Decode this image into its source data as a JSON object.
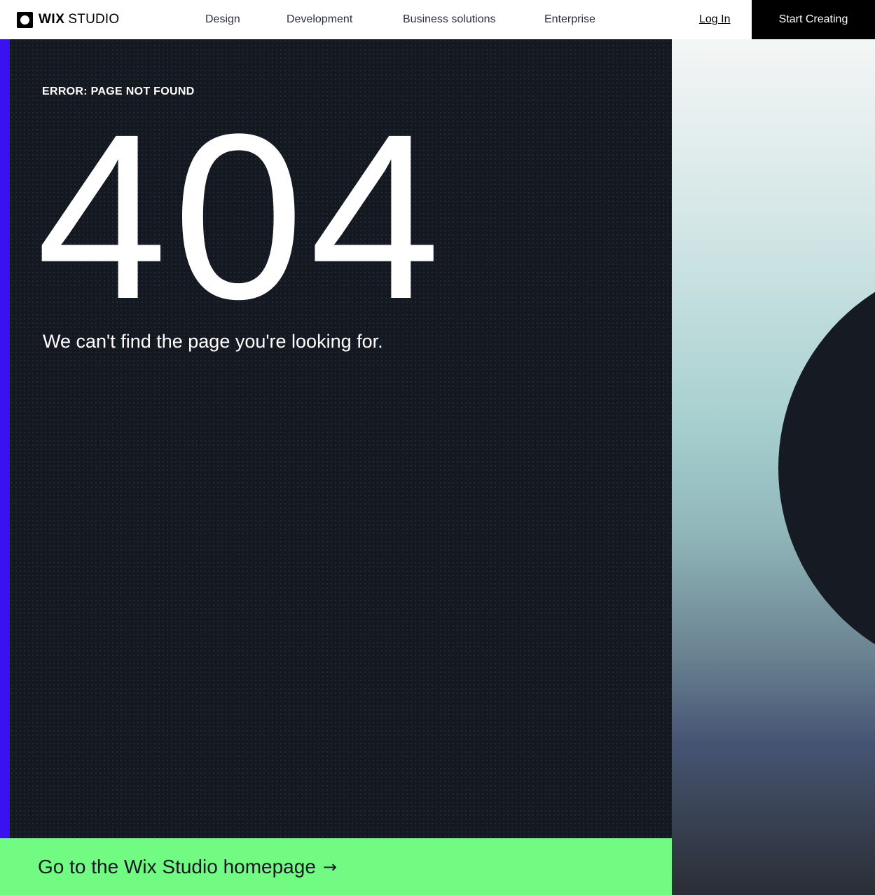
{
  "header": {
    "logo": {
      "brand_bold": "WIX",
      "brand_light": "STUDIO"
    },
    "nav": [
      {
        "label": "Design"
      },
      {
        "label": "Development"
      },
      {
        "label": "Business solutions"
      },
      {
        "label": "Enterprise"
      }
    ],
    "login_label": "Log In",
    "cta_label": "Start Creating"
  },
  "main": {
    "eyebrow": "ERROR: PAGE NOT FOUND",
    "error_code": "404",
    "message": "We can't find the page you're looking for."
  },
  "footer_link": {
    "label": "Go to the Wix Studio homepage",
    "arrow_icon": "arrow-right-icon",
    "arrow_glyph": "→"
  },
  "colors": {
    "accent_strip": "#3a11f0",
    "dark_panel": "#141821",
    "green_bar": "#72fb82",
    "cta_background": "#000000"
  }
}
